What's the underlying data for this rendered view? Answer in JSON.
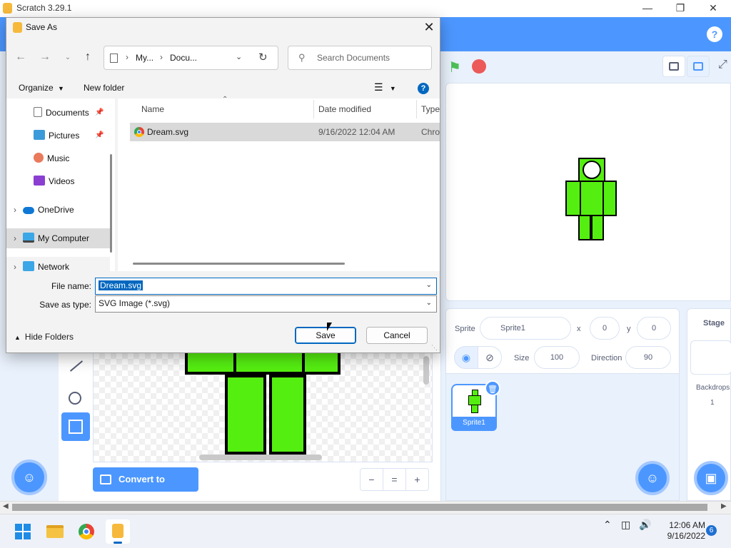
{
  "app": {
    "title": "Scratch 3.29.1"
  },
  "editor": {
    "convert_label": "Convert to Bitmap",
    "zoom_out": "−",
    "zoom_reset": "=",
    "zoom_in": "+"
  },
  "sprite_info": {
    "sprite_label": "Sprite",
    "sprite_name": "Sprite1",
    "x_label": "x",
    "x_value": "0",
    "y_label": "y",
    "y_value": "0",
    "show_label": "Show",
    "size_label": "Size",
    "size_value": "100",
    "direction_label": "Direction",
    "direction_value": "90"
  },
  "sprite_list": {
    "items": [
      {
        "name": "Sprite1"
      }
    ]
  },
  "stage_panel": {
    "title": "Stage",
    "backdrops_label": "Backdrops",
    "backdrops_count": "1"
  },
  "dialog": {
    "title": "Save As",
    "breadcrumb": [
      "My...",
      "Docu..."
    ],
    "search_placeholder": "Search Documents",
    "organize_label": "Organize",
    "new_folder_label": "New folder",
    "nav_items": [
      {
        "label": "Documents",
        "icon": "documents-icon",
        "pinned": true
      },
      {
        "label": "Pictures",
        "icon": "pictures-icon",
        "pinned": true
      },
      {
        "label": "Music",
        "icon": "music-icon"
      },
      {
        "label": "Videos",
        "icon": "videos-icon"
      },
      {
        "label": "OneDrive",
        "icon": "onedrive-icon"
      },
      {
        "label": "My Computer",
        "icon": "computer-icon"
      },
      {
        "label": "Network",
        "icon": "network-icon"
      }
    ],
    "columns": [
      "Name",
      "Date modified",
      "Type"
    ],
    "files": [
      {
        "name": "Dream.svg",
        "date": "9/16/2022 12:04 AM",
        "type": "Chro"
      }
    ],
    "file_name_label": "File name:",
    "file_name_value": "Dream.svg",
    "save_type_label": "Save as type:",
    "save_type_value": "SVG Image (*.svg)",
    "hide_folders_label": "Hide Folders",
    "save_label": "Save",
    "cancel_label": "Cancel"
  },
  "taskbar": {
    "time": "12:06 AM",
    "date": "9/16/2022",
    "notification_count": "6"
  },
  "colors": {
    "scratch_blue": "#4c97ff",
    "win_accent": "#0067c0",
    "sprite_green": "#55ee11"
  }
}
